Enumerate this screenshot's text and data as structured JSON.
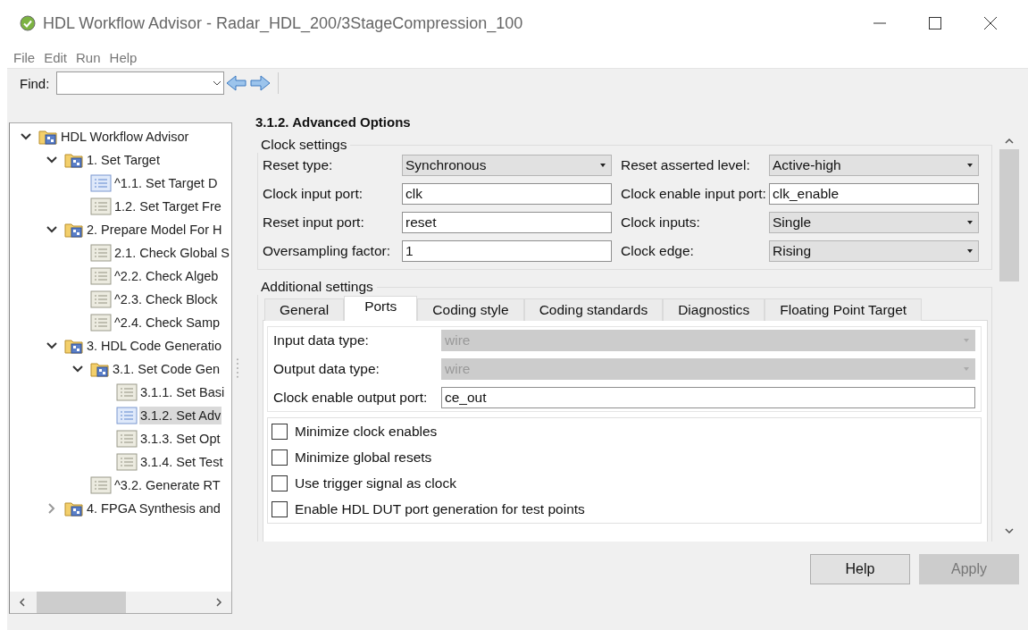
{
  "window": {
    "title": "HDL Workflow Advisor - Radar_HDL_200/3StageCompression_100"
  },
  "menu": [
    "File",
    "Edit",
    "Run",
    "Help"
  ],
  "toolbar": {
    "find_label": "Find:"
  },
  "tree": [
    {
      "label": "HDL Workflow Advisor",
      "kind": "folder",
      "expanded": true,
      "selected": false,
      "children": [
        {
          "label": "1. Set Target",
          "kind": "folder",
          "expanded": true,
          "selected": false,
          "children": [
            {
              "label": "^1.1. Set Target D",
              "kind": "current",
              "selected": false
            },
            {
              "label": "1.2. Set Target Fre",
              "kind": "task",
              "selected": false
            }
          ]
        },
        {
          "label": "2. Prepare Model For H",
          "kind": "folder",
          "expanded": true,
          "selected": false,
          "children": [
            {
              "label": "2.1. Check Global S",
              "kind": "task",
              "selected": false
            },
            {
              "label": "^2.2. Check Algeb",
              "kind": "task",
              "selected": false
            },
            {
              "label": "^2.3. Check Block",
              "kind": "task",
              "selected": false
            },
            {
              "label": "^2.4. Check Samp",
              "kind": "task",
              "selected": false
            }
          ]
        },
        {
          "label": "3. HDL Code Generatio",
          "kind": "folder",
          "expanded": true,
          "selected": false,
          "children": [
            {
              "label": "3.1. Set Code Gen",
              "kind": "folder",
              "expanded": true,
              "selected": false,
              "children": [
                {
                  "label": "3.1.1. Set Basi",
                  "kind": "task",
                  "selected": false
                },
                {
                  "label": "3.1.2. Set Adv",
                  "kind": "task",
                  "selected": true
                },
                {
                  "label": "3.1.3. Set Opt",
                  "kind": "task",
                  "selected": false
                },
                {
                  "label": "3.1.4. Set Test",
                  "kind": "task",
                  "selected": false
                }
              ]
            },
            {
              "label": "^3.2. Generate RT",
              "kind": "task",
              "selected": false
            }
          ]
        },
        {
          "label": "4. FPGA Synthesis and",
          "kind": "folder",
          "expanded": false,
          "selected": false
        }
      ]
    }
  ],
  "page": {
    "heading": "3.1.2. Advanced Options",
    "clock_settings": {
      "title": "Clock settings",
      "fields": [
        {
          "label": "Reset type:",
          "kind": "dropdown",
          "value": "Synchronous"
        },
        {
          "label": "Reset asserted level:",
          "kind": "dropdown",
          "value": "Active-high"
        },
        {
          "label": "Clock input port:",
          "kind": "text",
          "value": "clk"
        },
        {
          "label": "Clock enable input port:",
          "kind": "text",
          "value": "clk_enable"
        },
        {
          "label": "Reset input port:",
          "kind": "text",
          "value": "reset"
        },
        {
          "label": "Clock inputs:",
          "kind": "dropdown",
          "value": "Single"
        },
        {
          "label": "Oversampling factor:",
          "kind": "text",
          "value": "1"
        },
        {
          "label": "Clock edge:",
          "kind": "dropdown",
          "value": "Rising"
        }
      ]
    },
    "additional_settings": {
      "title": "Additional settings",
      "tabs": [
        {
          "label": "General",
          "selected": false
        },
        {
          "label": "Ports",
          "selected": true
        },
        {
          "label": "Coding style",
          "selected": false
        },
        {
          "label": "Coding standards",
          "selected": false
        },
        {
          "label": "Diagnostics",
          "selected": false
        },
        {
          "label": "Floating Point Target",
          "selected": false
        }
      ],
      "fields": [
        {
          "label": "Input data type:",
          "kind": "dropdown",
          "value": "wire",
          "disabled": true
        },
        {
          "label": "Output data type:",
          "kind": "dropdown",
          "value": "wire",
          "disabled": true
        },
        {
          "label": "Clock enable output port:",
          "kind": "text",
          "value": "ce_out",
          "disabled": false
        }
      ],
      "options": [
        {
          "label": "Minimize clock enables",
          "checked": false
        },
        {
          "label": "Minimize global resets",
          "checked": false
        },
        {
          "label": "Use trigger signal as clock",
          "checked": false
        },
        {
          "label": "Enable HDL DUT port generation for test points",
          "checked": false
        }
      ]
    }
  },
  "buttons": [
    {
      "label": "Help",
      "disabled": false
    },
    {
      "label": "Apply",
      "disabled": true
    }
  ]
}
